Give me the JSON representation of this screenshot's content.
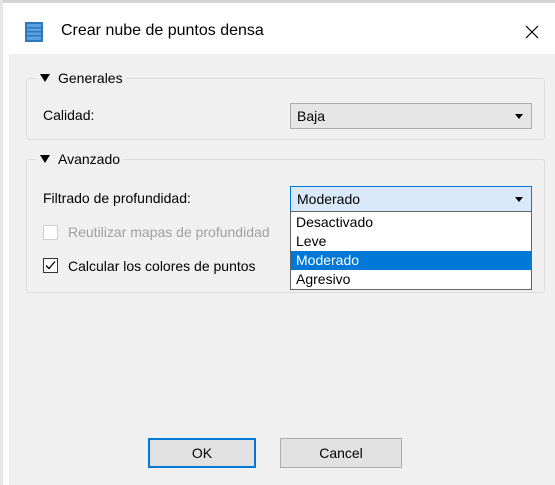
{
  "window": {
    "title": "Crear nube de puntos densa",
    "icon": "film-strip-icon",
    "accent": "#0078d7"
  },
  "general": {
    "title": "Generales",
    "quality_label": "Calidad:",
    "quality_value": "Baja"
  },
  "advanced": {
    "title": "Avanzado",
    "depth_filter_label": "Filtrado de profundidad:",
    "depth_filter_value": "Moderado",
    "reuse_depth_label": "Reutilizar mapas de profundidad",
    "reuse_depth_checked": false,
    "reuse_depth_enabled": false,
    "point_colors_label": "Calcular los colores de puntos",
    "point_colors_checked": true
  },
  "dropdown": {
    "options": [
      "Desactivado",
      "Leve",
      "Moderado",
      "Agresivo"
    ],
    "selected": "Moderado"
  },
  "buttons": {
    "ok": "OK",
    "cancel": "Cancel"
  }
}
